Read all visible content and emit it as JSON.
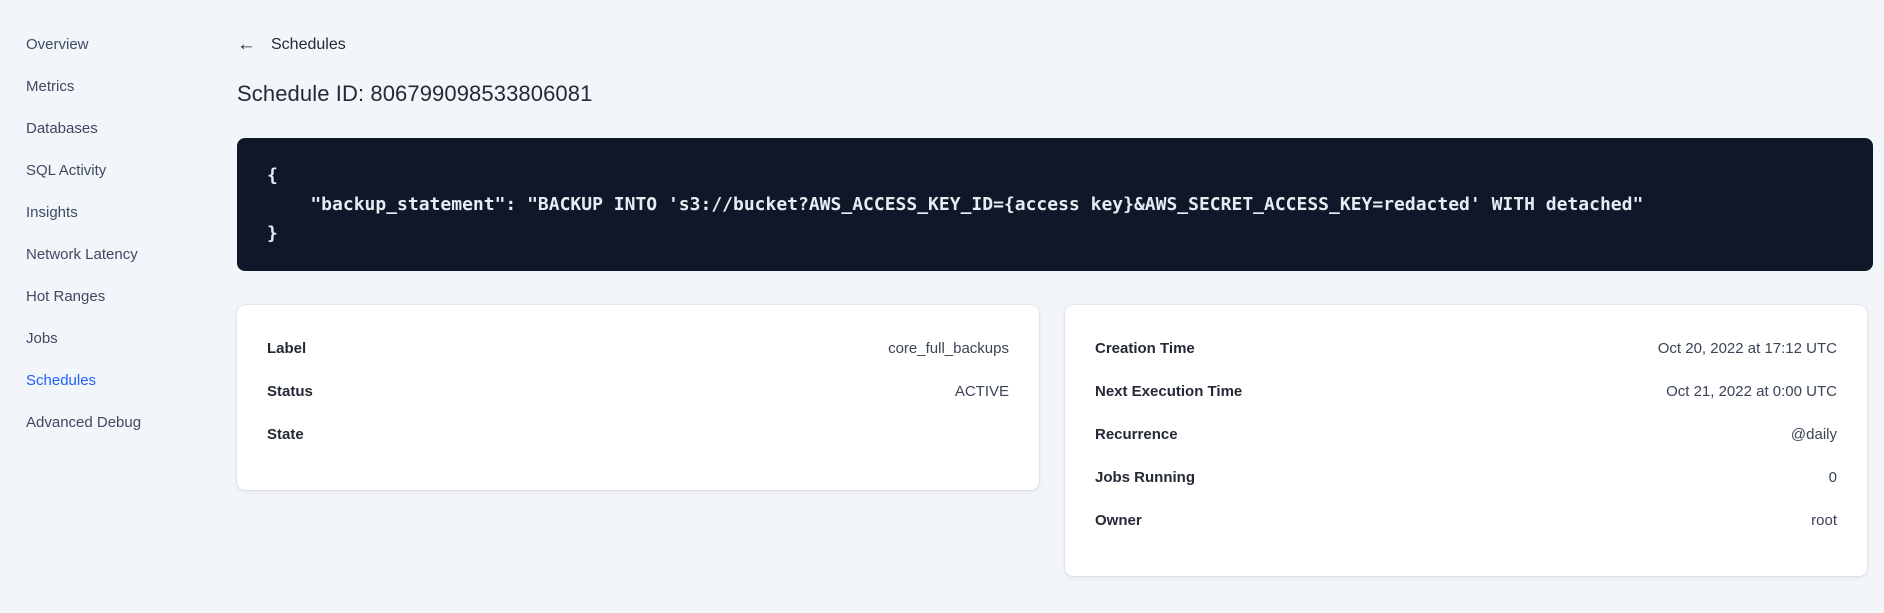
{
  "colors": {
    "page_background": "#f2f5f9",
    "active_nav_link": "#1f5eff",
    "code_block_background": "#101728",
    "code_text": "#e7ecf3"
  },
  "icons": {
    "back_arrow": "←"
  },
  "sidebar": {
    "items": [
      {
        "label": "Overview",
        "active": false
      },
      {
        "label": "Metrics",
        "active": false
      },
      {
        "label": "Databases",
        "active": false
      },
      {
        "label": "SQL Activity",
        "active": false
      },
      {
        "label": "Insights",
        "active": false
      },
      {
        "label": "Network Latency",
        "active": false
      },
      {
        "label": "Hot Ranges",
        "active": false
      },
      {
        "label": "Jobs",
        "active": false
      },
      {
        "label": "Schedules",
        "active": true
      },
      {
        "label": "Advanced Debug",
        "active": false
      }
    ]
  },
  "header": {
    "back_label": "Schedules",
    "title": "Schedule ID: 806799098533806081"
  },
  "code_block": {
    "lines": [
      "{",
      "    \"backup_statement\": \"BACKUP INTO 's3://bucket?AWS_ACCESS_KEY_ID={access key}&AWS_SECRET_ACCESS_KEY=redacted' WITH detached\"",
      "}"
    ]
  },
  "details_card": {
    "rows": [
      {
        "label": "Label",
        "value": "core_full_backups"
      },
      {
        "label": "Status",
        "value": "ACTIVE"
      },
      {
        "label": "State",
        "value": ""
      }
    ]
  },
  "schedule_card": {
    "rows": [
      {
        "label": "Creation Time",
        "value": "Oct 20, 2022 at 17:12 UTC"
      },
      {
        "label": "Next Execution Time",
        "value": "Oct 21, 2022 at 0:00 UTC"
      },
      {
        "label": "Recurrence",
        "value": "@daily"
      },
      {
        "label": "Jobs Running",
        "value": "0"
      },
      {
        "label": "Owner",
        "value": "root"
      }
    ]
  }
}
